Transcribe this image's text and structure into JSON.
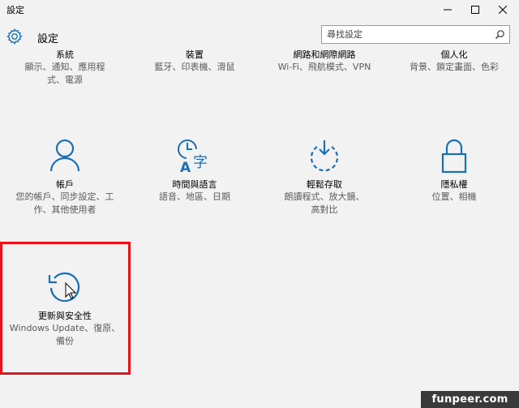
{
  "window": {
    "title": "設定",
    "minimize_icon": "minimize-icon",
    "maximize_icon": "maximize-icon",
    "close_icon": "close-icon"
  },
  "header": {
    "icon": "gear-icon",
    "title": "設定",
    "search": {
      "placeholder": "尋找設定",
      "value": "",
      "icon": "search-icon"
    }
  },
  "accent_color": "#1a6fb5",
  "categories": [
    {
      "name": "系統",
      "desc": "顯示、通知、應用程式、電源"
    },
    {
      "name": "裝置",
      "desc": "藍牙、印表機、滑鼠"
    },
    {
      "name": "網路和網際網路",
      "desc": "Wi-Fi、飛航模式、VPN"
    },
    {
      "name": "個人化",
      "desc": "背景、鎖定畫面、色彩"
    },
    {
      "name": "帳戶",
      "desc": "您的帳戶、同步設定、工作、其他使用者",
      "icon": "person-icon"
    },
    {
      "name": "時間與語言",
      "desc": "語音、地區、日期",
      "icon": "time-language-icon"
    },
    {
      "name": "輕鬆存取",
      "desc": "朗讀程式、放大鏡、高對比",
      "icon": "ease-of-access-icon"
    },
    {
      "name": "隱私權",
      "desc": "位置、相機",
      "icon": "lock-icon"
    },
    {
      "name": "更新與安全性",
      "desc": "Windows Update、復原、備份",
      "icon": "update-icon"
    }
  ],
  "highlight_color": "#e8141c",
  "watermark": "funpeer.com"
}
